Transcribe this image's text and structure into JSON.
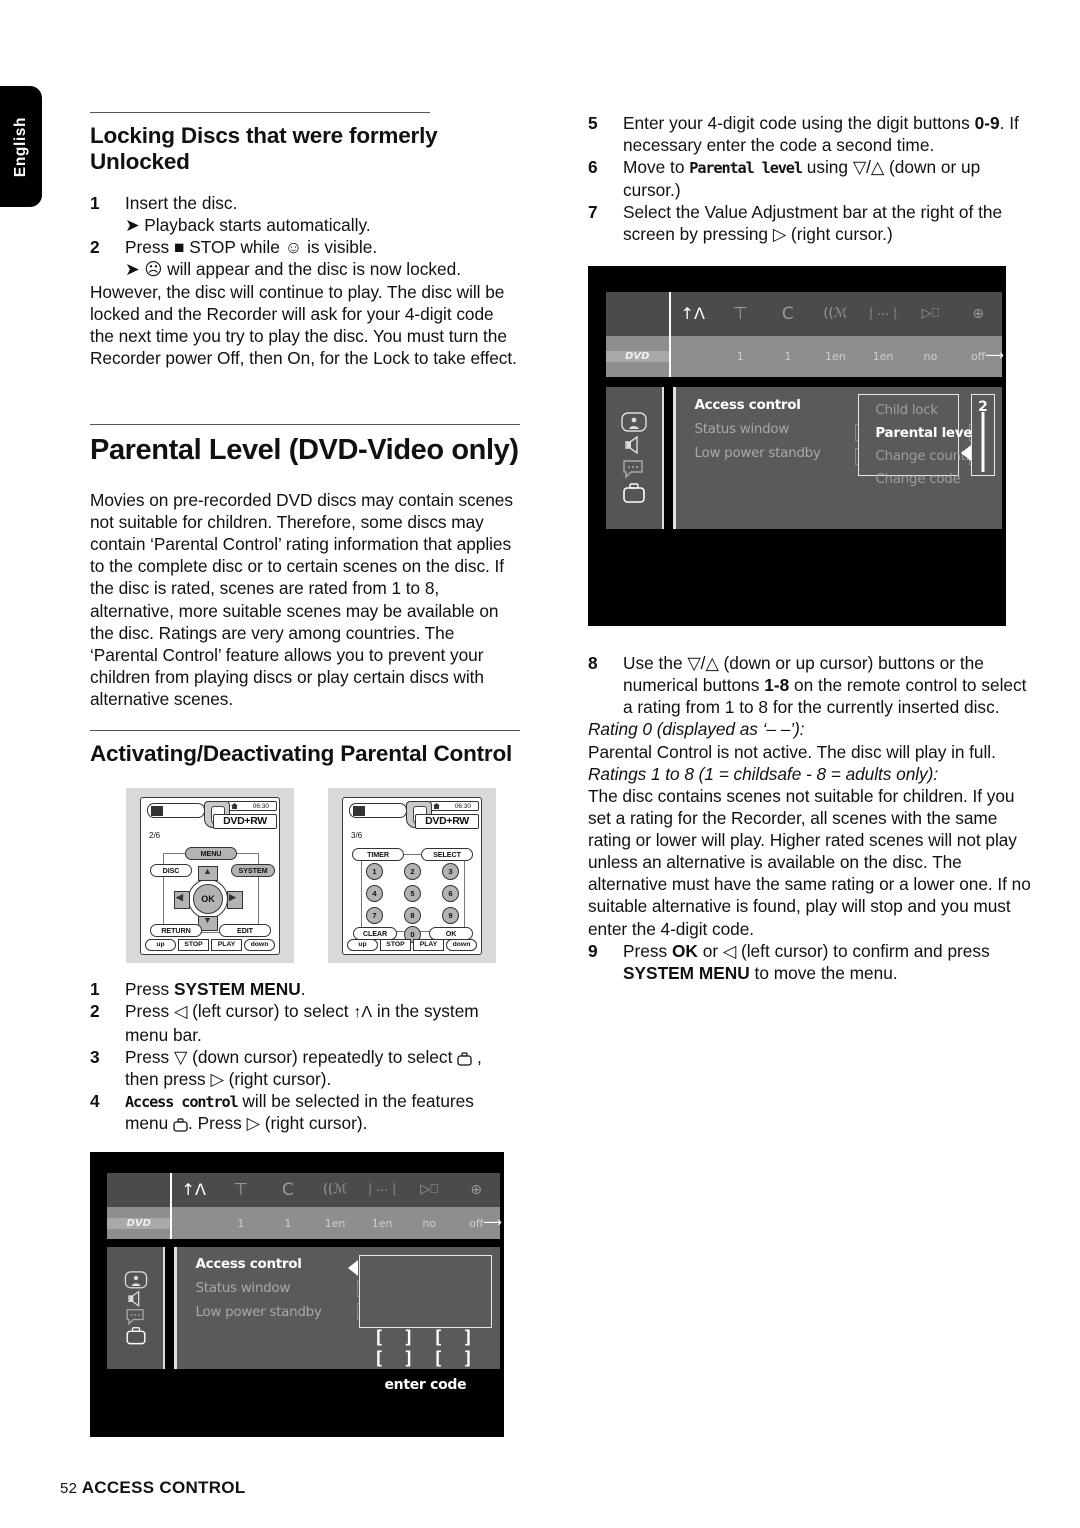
{
  "side_tab": {
    "label": "English"
  },
  "left_column": {
    "heading1": "Locking Discs that were formerly Unlocked",
    "steps1": [
      {
        "num": "1",
        "text": "Insert the disc."
      },
      {
        "num": "2",
        "text": "Press ■ STOP while ☺ is visible."
      }
    ],
    "sub1": "➤ Playback starts automatically.",
    "sub2": "➤ ☹ will appear and the disc is now locked.",
    "step2_pre": "Press ",
    "step2_bold": "■ STOP",
    "step2_post": " while",
    "step2_end": "is visible.",
    "para1": "However, the disc will continue to play. The disc will be locked and the Recorder will ask for your 4-digit code the next time you try to play the disc. You must turn the Recorder power Off, then On, for the Lock to take effect.",
    "heading2": "Parental Level (DVD-Video only)",
    "para2": "Movies on pre-recorded DVD discs may contain scenes not suitable for children. Therefore, some discs may contain ‘Parental Control’ rating information that applies to the complete disc or to certain scenes on the disc. If the disc is rated, scenes are rated from 1 to 8, alternative, more suitable scenes may be available on the disc. Ratings are very among countries. The ‘Parental Control’ feature allows you to prevent your children from playing discs or play certain discs with alternative scenes.",
    "heading3": "Activating/Deactivating Parental Control",
    "steps2": [
      {
        "num": "1",
        "pre": "Press ",
        "bold": "SYSTEM MENU",
        "post": "."
      },
      {
        "num": "2",
        "pre": "Press ◁ (left cursor) to select ",
        "icon": "antenna-icon",
        "post": " in the system menu bar."
      },
      {
        "num": "3",
        "pre": "Press ▽ (down cursor) repeatedly to select ",
        "icon": "briefcase-icon",
        "post": " , then press ▷ (right cursor)."
      },
      {
        "num": "4",
        "lcd": "Access control",
        "post": " will be selected in the features menu ",
        "icon": "briefcase-icon",
        "tail": ". Press ▷ (right cursor)."
      }
    ]
  },
  "right_column": {
    "steps": [
      {
        "num": "5",
        "pre": "Enter your 4-digit code using the digit buttons ",
        "bold": "0-9",
        "post": ". If necessary enter the code a second time."
      },
      {
        "num": "6",
        "pre": "Move to ",
        "lcd": "Parental level",
        "post": " using ▽/△ (down or up cursor.)"
      },
      {
        "num": "7",
        "pre": "Select the Value Adjustment bar at the right of the screen by pressing ▷ (right cursor.)"
      }
    ],
    "step8": {
      "num": "8",
      "pre": "Use the ▽/△ (down or up cursor) buttons or the numerical buttons ",
      "bold": "1-8",
      "post": " on the remote control to select a rating from 1 to 8 for the currently inserted disc."
    },
    "italic1": "Rating 0 (displayed as ‘– –’):",
    "para1": "Parental Control is not active. The disc will play in full.",
    "italic2": "Ratings 1 to 8 (1 = childsafe - 8 = adults only):",
    "para2": "The disc contains scenes not suitable for children. If you set a rating for the Recorder, all scenes with the same rating or lower will play. Higher rated scenes will not play unless an alternative is available on the disc. The alternative must have the same rating or a lower one. If no suitable alternative is found, play will stop and you must enter the 4-digit code.",
    "step9": {
      "num": "9",
      "pre": "Press ",
      "bold1": "OK",
      "mid": " or ◁ (left cursor) to confirm and press ",
      "bold2": "SYSTEM MENU",
      "post": " to move the menu."
    }
  },
  "tv_screen_top": {
    "menubar": {
      "icons": [
        "dvd-disc-icon",
        "antenna-tool-icon",
        "tuner-T-icon",
        "tuner-C-icon",
        "audio-language-icon",
        "subtitle-icon",
        "camera-angle-icon",
        "zoom-icon"
      ],
      "values": [
        "DVD",
        "1",
        "1",
        "1en",
        "1en",
        "no",
        "off"
      ]
    },
    "sidebar_icons": [
      "picture-icon",
      "sound-icon",
      "language-icon",
      "features-icon"
    ],
    "menu_items": [
      {
        "label": "Access control",
        "selected": true
      },
      {
        "label": "Status window",
        "selected": false
      },
      {
        "label": "Low power standby",
        "selected": false
      }
    ],
    "popup_items": [
      {
        "label": "Child lock",
        "selected": false
      },
      {
        "label": "Parental level",
        "selected": true
      },
      {
        "label": "Change country",
        "selected": false
      },
      {
        "label": "Change code",
        "selected": false
      }
    ],
    "value_bar": {
      "value": "2"
    }
  },
  "tv_screen_bottom": {
    "menubar": {
      "values": [
        "DVD",
        "1",
        "1",
        "1en",
        "1en",
        "no",
        "off"
      ]
    },
    "menu_items": [
      {
        "label": "Access control",
        "selected": true
      },
      {
        "label": "Status window",
        "selected": false
      },
      {
        "label": "Low power standby",
        "selected": false
      }
    ],
    "dialog": {
      "boxes": "[ ] [ ] [ ] [ ]",
      "label": "enter code"
    }
  },
  "remote_left": {
    "page": "2/6",
    "badge": "DVD+RW",
    "clock": "06:30",
    "buttons": {
      "menu": "MENU",
      "disc": "DISC",
      "system": "SYSTEM",
      "ok": "OK",
      "return": "RETURN",
      "edit": "EDIT"
    },
    "bottom_row": [
      "up",
      "STOP",
      "PLAY",
      "down"
    ]
  },
  "remote_right": {
    "page": "3/6",
    "badge": "DVD+RW",
    "clock": "06:30",
    "buttons": {
      "timer": "TIMER",
      "select": "SELECT",
      "clear": "CLEAR",
      "ok": "OK"
    },
    "digits": [
      "1",
      "2",
      "3",
      "4",
      "5",
      "6",
      "7",
      "8",
      "9",
      "0"
    ],
    "bottom_row": [
      "up",
      "STOP",
      "PLAY",
      "down"
    ]
  },
  "footer": {
    "page_number": "52",
    "title": "ACCESS CONTROL"
  }
}
